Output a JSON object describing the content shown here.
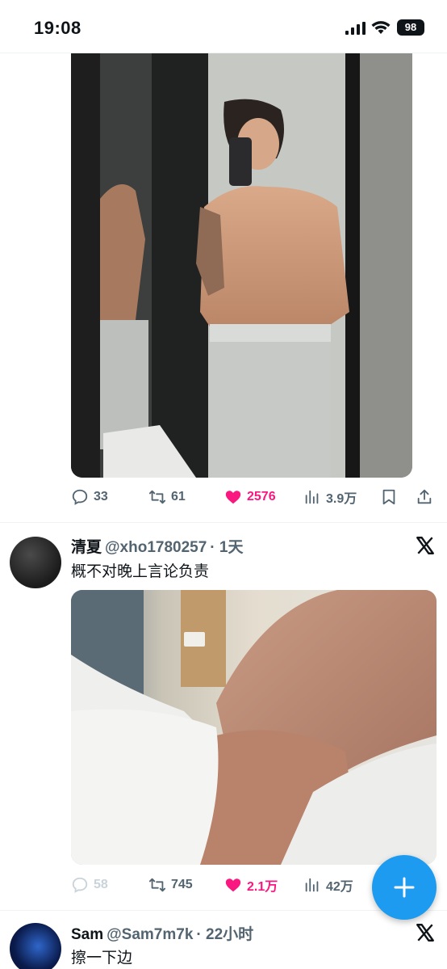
{
  "status_bar": {
    "time": "19:08",
    "battery": "98"
  },
  "posts": [
    {
      "image": "photo",
      "actions": {
        "replies": "33",
        "reposts": "61",
        "likes": "2576",
        "views": "3.9万"
      }
    },
    {
      "name": "清夏",
      "handle": "@xho1780257",
      "time": "· 1天",
      "text": "概不对晚上言论负责",
      "image": "photo",
      "actions": {
        "replies": "58",
        "reposts": "745",
        "likes": "2.1万",
        "views": "42万"
      }
    },
    {
      "name": "Sam",
      "handle": "@Sam7m7k",
      "time": "· 22小时",
      "text": "擦一下边"
    }
  ],
  "icons": [
    "signal-icon",
    "wifi-icon",
    "reply-icon",
    "repost-icon",
    "like-icon",
    "views-icon",
    "bookmark-icon",
    "share-icon",
    "x-logo-icon",
    "plus-icon"
  ],
  "colors": {
    "like": "#f91880",
    "accent": "#1d9bf0",
    "muted": "#536471"
  }
}
